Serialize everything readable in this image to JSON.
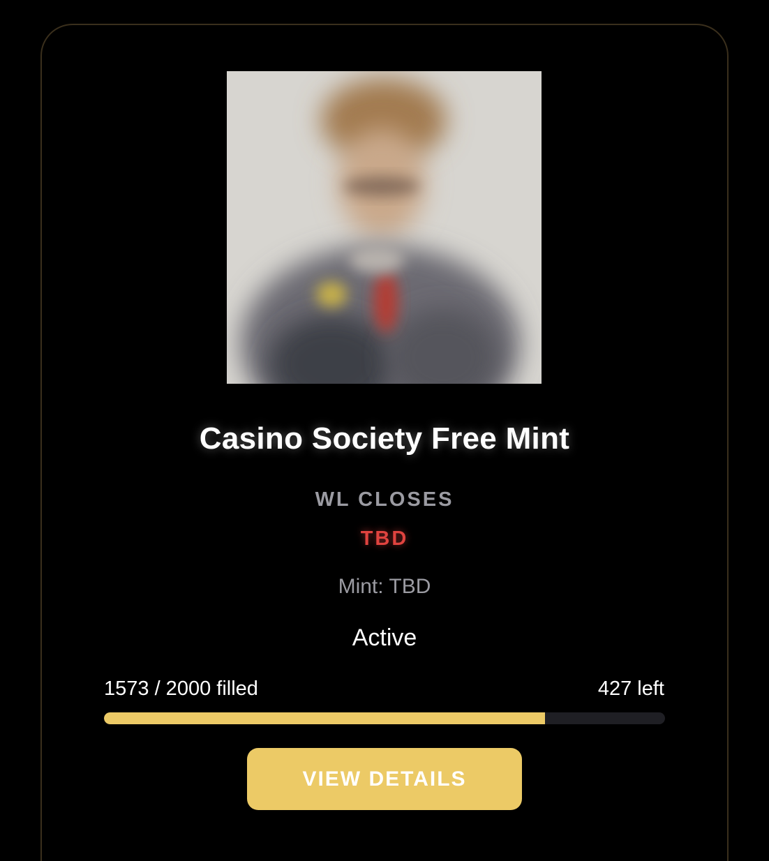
{
  "card": {
    "title": "Casino Society Free Mint",
    "wl_label": "WL CLOSES",
    "wl_value": "TBD",
    "mint_text": "Mint: TBD",
    "status": "Active",
    "progress": {
      "filled_text": "1573 / 2000 filled",
      "left_text": "427 left",
      "filled": 1573,
      "total": 2000,
      "fraction": 0.7865
    },
    "button_label": "VIEW DETAILS"
  },
  "colors": {
    "background": "#000000",
    "card_border": "#3a2f1c",
    "accent": "#ecca66",
    "tbd_red": "#e0433f",
    "muted_text": "#9b9ba2",
    "track": "#1f1f24"
  },
  "icons": {
    "thumbnail": "blurred-nft-portrait-image"
  }
}
